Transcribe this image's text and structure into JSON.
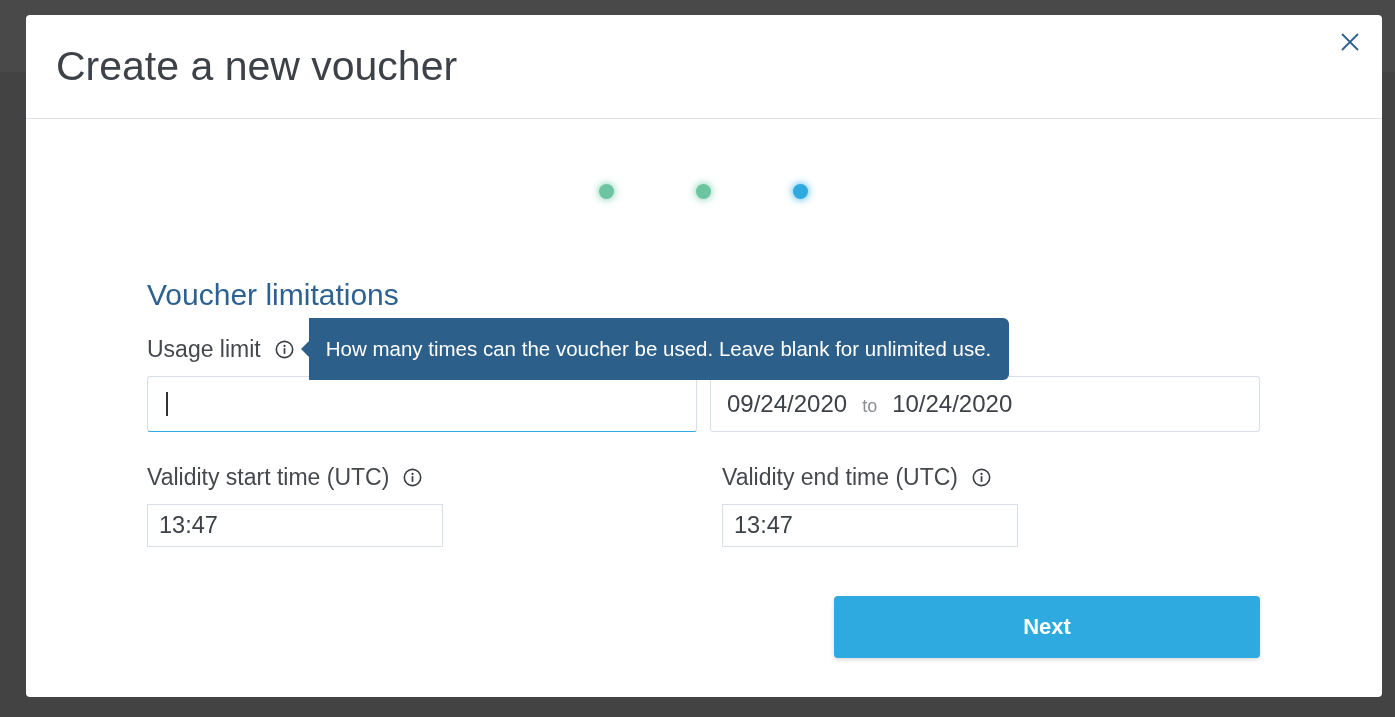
{
  "dialog": {
    "title": "Create a new voucher"
  },
  "steps": [
    {
      "color": "#6cc5a0"
    },
    {
      "color": "#6cc5a0"
    },
    {
      "color": "#2eaae1"
    }
  ],
  "section": {
    "heading": "Voucher limitations"
  },
  "usage_limit": {
    "label": "Usage limit",
    "focused": true,
    "tooltip": "How many times can the voucher be used. Leave blank for unlimited use."
  },
  "validity_period": {
    "start_date": "09/24/2020",
    "separator": "to",
    "end_date": "10/24/2020"
  },
  "time_fields": [
    {
      "label": "Validity start time (UTC)",
      "value": "13:47"
    },
    {
      "label": "Validity end time (UTC)",
      "value": "13:47"
    }
  ],
  "buttons": {
    "next": "Next"
  }
}
